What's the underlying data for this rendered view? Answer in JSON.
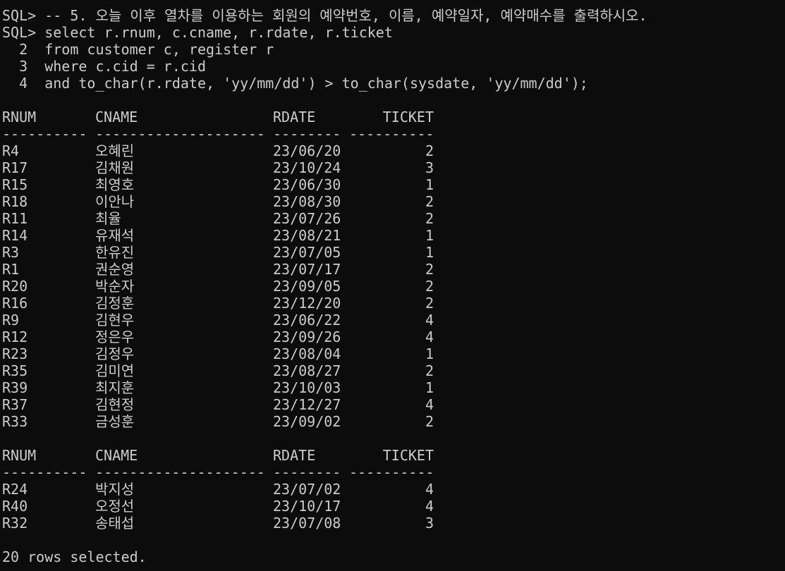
{
  "colors": {
    "background": "#0c0c0c",
    "foreground": "#cccccc"
  },
  "query": {
    "lines": [
      "SQL> -- 5. 오늘 이후 열차를 이용하는 회원의 예약번호, 이름, 예약일자, 예약매수를 출력하시오.",
      "SQL> select r.rnum, c.cname, r.rdate, r.ticket",
      "  2  from customer c, register r",
      "  3  where c.cid = r.cid",
      "  4  and to_char(r.rdate, 'yy/mm/dd') > to_char(sysdate, 'yy/mm/dd');"
    ]
  },
  "result": {
    "headers": {
      "rnum": "RNUM",
      "cname": "CNAME",
      "rdate": "RDATE",
      "ticket": "TICKET"
    },
    "underline": {
      "rnum": "----------",
      "cname": "--------------------",
      "rdate": "--------",
      "ticket": "----------"
    },
    "page1": [
      {
        "rnum": "R4",
        "cname": "오혜린",
        "rdate": "23/06/20",
        "ticket": "2"
      },
      {
        "rnum": "R17",
        "cname": "김채원",
        "rdate": "23/10/24",
        "ticket": "3"
      },
      {
        "rnum": "R15",
        "cname": "최영호",
        "rdate": "23/06/30",
        "ticket": "1"
      },
      {
        "rnum": "R18",
        "cname": "이안나",
        "rdate": "23/08/30",
        "ticket": "2"
      },
      {
        "rnum": "R11",
        "cname": "최율",
        "rdate": "23/07/26",
        "ticket": "2"
      },
      {
        "rnum": "R14",
        "cname": "유재석",
        "rdate": "23/08/21",
        "ticket": "1"
      },
      {
        "rnum": "R3",
        "cname": "한유진",
        "rdate": "23/07/05",
        "ticket": "1"
      },
      {
        "rnum": "R1",
        "cname": "권순영",
        "rdate": "23/07/17",
        "ticket": "2"
      },
      {
        "rnum": "R20",
        "cname": "박순자",
        "rdate": "23/09/05",
        "ticket": "2"
      },
      {
        "rnum": "R16",
        "cname": "김정훈",
        "rdate": "23/12/20",
        "ticket": "2"
      },
      {
        "rnum": "R9",
        "cname": "김현우",
        "rdate": "23/06/22",
        "ticket": "4"
      },
      {
        "rnum": "R12",
        "cname": "정은우",
        "rdate": "23/09/26",
        "ticket": "4"
      },
      {
        "rnum": "R23",
        "cname": "김정우",
        "rdate": "23/08/04",
        "ticket": "1"
      },
      {
        "rnum": "R35",
        "cname": "김미연",
        "rdate": "23/08/27",
        "ticket": "2"
      },
      {
        "rnum": "R39",
        "cname": "최지훈",
        "rdate": "23/10/03",
        "ticket": "1"
      },
      {
        "rnum": "R37",
        "cname": "김현정",
        "rdate": "23/12/27",
        "ticket": "4"
      },
      {
        "rnum": "R33",
        "cname": "금성훈",
        "rdate": "23/09/02",
        "ticket": "2"
      }
    ],
    "page2": [
      {
        "rnum": "R24",
        "cname": "박지성",
        "rdate": "23/07/02",
        "ticket": "4"
      },
      {
        "rnum": "R40",
        "cname": "오정선",
        "rdate": "23/10/17",
        "ticket": "4"
      },
      {
        "rnum": "R32",
        "cname": "송태섭",
        "rdate": "23/07/08",
        "ticket": "3"
      }
    ],
    "summary": "20 rows selected."
  }
}
